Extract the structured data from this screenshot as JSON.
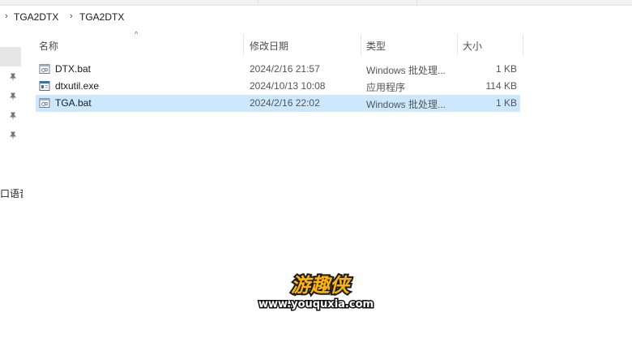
{
  "breadcrumb": {
    "items": [
      "TGA2DTX",
      "TGA2DTX"
    ]
  },
  "nav": {
    "clipped_text": "口语音"
  },
  "columns": {
    "name": "名称",
    "date": "修改日期",
    "type": "类型",
    "size": "大小"
  },
  "files": [
    {
      "icon": "bat-file-icon",
      "name": "DTX.bat",
      "date": "2024/2/16 21:57",
      "type": "Windows 批处理...",
      "size": "1 KB",
      "selected": false
    },
    {
      "icon": "exe-file-icon",
      "name": "dtxutil.exe",
      "date": "2024/10/13 10:08",
      "type": "应用程序",
      "size": "114 KB",
      "selected": false
    },
    {
      "icon": "bat-file-icon",
      "name": "TGA.bat",
      "date": "2024/2/16 22:02",
      "type": "Windows 批处理...",
      "size": "1 KB",
      "selected": true
    }
  ],
  "watermark": {
    "logo_text": "游趣侠",
    "url": "www.youquxia.com"
  },
  "colors": {
    "selection": "#cce8ff",
    "nav_selected": "#e6e6e6",
    "watermark_fill": "#ffb400"
  }
}
